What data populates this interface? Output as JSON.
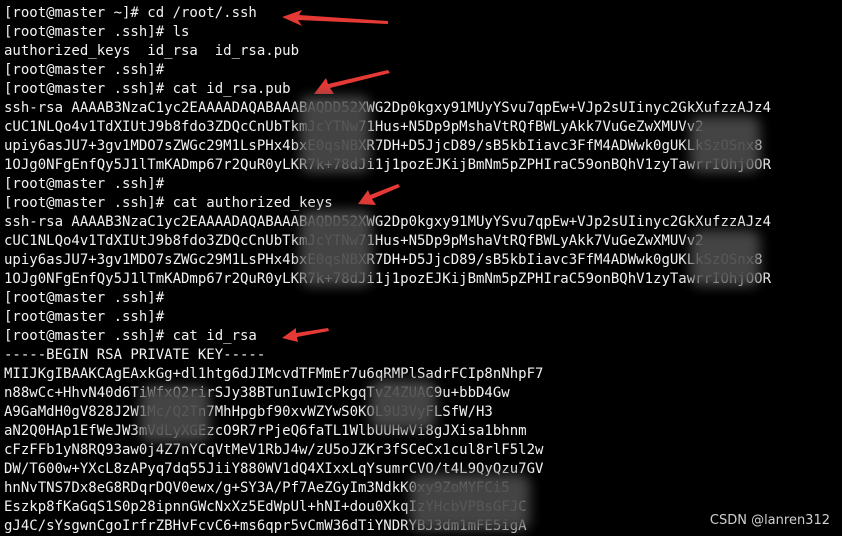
{
  "terminal": {
    "lines": [
      "[root@master ~]# cd /root/.ssh",
      "[root@master .ssh]# ls",
      "authorized_keys  id_rsa  id_rsa.pub",
      "[root@master .ssh]#",
      "[root@master .ssh]# cat id_rsa.pub",
      "ssh-rsa AAAAB3NzaC1yc2EAAAADAQABAAABAQDD52XWG2Dp0kgxy91MUyYSvu7qpEw+VJp2sUIinyc2GkXufzzAJz4",
      "cUC1NLQo4v1TdXIUtJ9b8fdo3ZDQcCnUbTkmJcYTNw71Hus+N5Dp9pMshaVtRQfBWLyAkk7VuGeZwXMUVv2",
      "upiy6asJU7+3gv1MDO7sZWGc29M1LsPHx4bxE0qsNBXR7DH+D5JjcD89/sB5kbIiavc3FfM4ADWwk0gUKLkSzOSnx8",
      "1OJg0NFgEnfQy5J1lTmKADmp67r2QuR0yLKR7k+78dJi1j1pozEJKijBmNm5pZPHIraC59onBQhV1zyTawrrIOhjOOR",
      "[root@master .ssh]#",
      "[root@master .ssh]# cat authorized_keys",
      "ssh-rsa AAAAB3NzaC1yc2EAAAADAQABAAABAQDD52XWG2Dp0kgxy91MUyYSvu7qpEw+VJp2sUIinyc2GkXufzzAJz4",
      "cUC1NLQo4v1TdXIUtJ9b8fdo3ZDQcCnUbTkmJcYTNw71Hus+N5Dp9pMshaVtRQfBWLyAkk7VuGeZwXMUVv2",
      "upiy6asJU7+3gv1MDO7sZWGc29M1LsPHx4bxE0qsNBXR7DH+D5JjcD89/sB5kbIiavc3FfM4ADWwk0gUKLkSzOSnx8",
      "1OJg0NFgEnfQy5J1lTmKADmp67r2QuR0yLKR7k+78dJi1j1pozEJKijBmNm5pZPHIraC59onBQhV1zyTawrrIOhjOOR",
      "[root@master .ssh]#",
      "[root@master .ssh]#",
      "[root@master .ssh]# cat id_rsa",
      "-----BEGIN RSA PRIVATE KEY-----",
      "MIIJKgIBAAKCAgEAxkGg+dl1htg6dJIMcvdTFMmEr7u6qRMPlSadrFCIp8nNhpF7",
      "n88wCc+HhvN40d6TiWfxQ2rirSJy38BTunIuwIcPkgqTvZ4ZUAC9u+bbD4Gw",
      "A9GaMdH0gV828J2W1Mc/Q2Tn7MhHpgbf90xvWZYwS0KOL9U3VyFLSfW/H3",
      "aN2Q0HAp1EfWeJW3mVdLyXGEzcO9R7rPjeQ6faTL1WlbUUHwVi8gJXisa1bhnm",
      "cFzFFb1yN8RQ93aw0j4Z7nYCqVtMeV1RbJ4w/zU5oJZKr3fSCeCx1cul8rlF5l2w",
      "DW/T600w+YXcL8zAPyq7dq55JiiY880WV1dQ4XIxxLqYsumrCVO/t4L9QyQzu7GV",
      "hnNvTNS7Dx8eG8RDqrDQV0ewx/g+SY3A/Pf7AeZGyIm3NdkK0xy9ZoMYFCi5",
      "Eszkp8fKaGqS1S0p28ipnnGWcNxXz5EdWpUl+hNI+dou0XkqIzYHcbVPBsGFJC",
      "gJ4C/sYsgwnCgoIrfrZBHvFcvC6+ms6qpr5vCmW36dTiYNDRYBJ3dm1mFE5igA"
    ],
    "background_color": "#000000",
    "text_color": "#f2f2f2"
  },
  "annotation": {
    "arrow_color": "#e53935",
    "mask_color": "#4a4a4a"
  },
  "watermark": {
    "text": "CSDN @lanren312"
  }
}
